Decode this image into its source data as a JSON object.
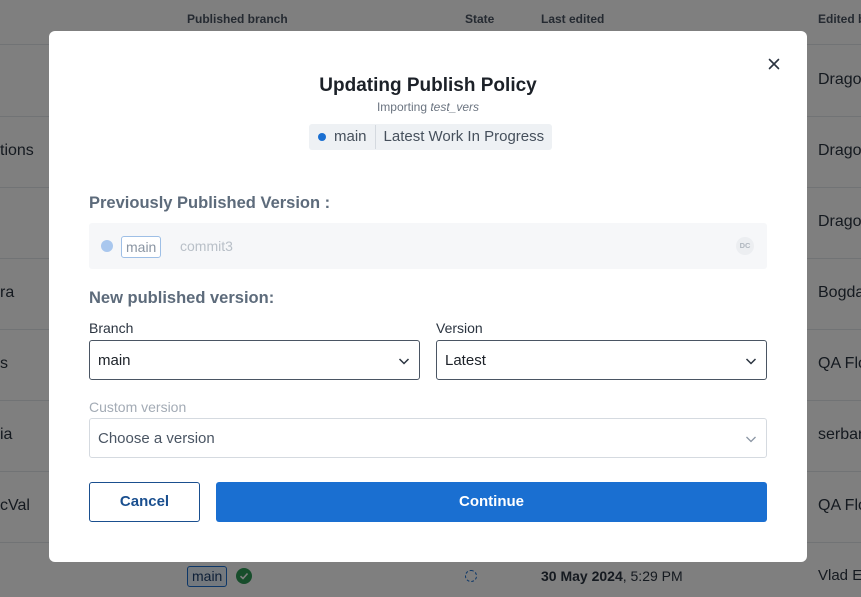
{
  "background": {
    "headers": {
      "published_branch": "Published branch",
      "state": "State",
      "last_edited": "Last edited",
      "edited_by": "Edited b"
    },
    "rows": [
      {
        "left": "",
        "right": "Drago"
      },
      {
        "left": "tions",
        "right": "Drago"
      },
      {
        "left": "",
        "right": "Drago"
      },
      {
        "left": "ra",
        "right": "Bogda"
      },
      {
        "left": "s",
        "right": "QA Flo"
      },
      {
        "left": "ia",
        "right": "serban"
      },
      {
        "left": "cVal",
        "right": "QA Flo"
      }
    ],
    "bottom_row": {
      "branch": "main",
      "date_bold": "30 May 2024",
      "date_rest": ", 5:29 PM",
      "editor": "Vlad E"
    }
  },
  "modal": {
    "title": "Updating Publish Policy",
    "subtitle_prefix": "Importing",
    "subtitle_project": "test_vers",
    "pill": {
      "branch": "main",
      "version": "Latest Work In Progress"
    },
    "previous": {
      "label": "Previously Published Version :",
      "branch": "main",
      "commit": "commit3",
      "avatar_initials": "DC"
    },
    "new_version": {
      "label": "New published version:",
      "branch_label": "Branch",
      "branch_value": "main",
      "version_label": "Version",
      "version_value": "Latest",
      "custom_label": "Custom version",
      "custom_placeholder": "Choose a version"
    },
    "buttons": {
      "cancel": "Cancel",
      "continue": "Continue"
    }
  },
  "colors": {
    "accent": "#1a6fd1",
    "overlay": "rgba(0,0,0,0.5)",
    "success": "#2e9a57"
  }
}
